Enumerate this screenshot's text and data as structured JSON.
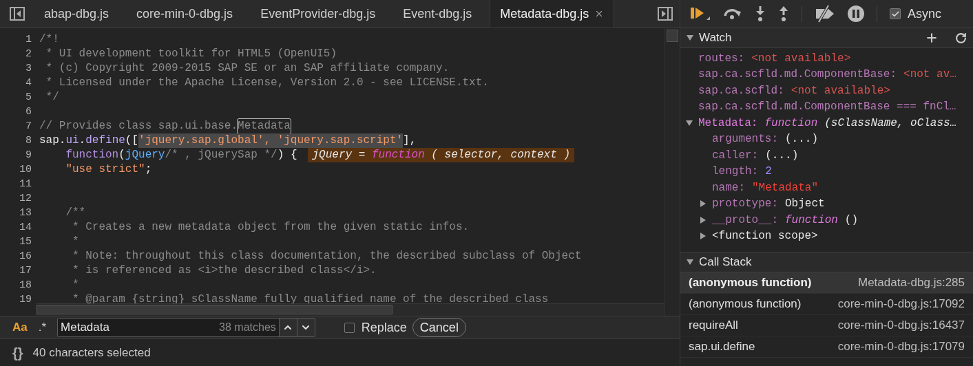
{
  "editor": {
    "tabs": [
      {
        "label": "abap-dbg.js",
        "selected": false
      },
      {
        "label": "core-min-0-dbg.js",
        "selected": false
      },
      {
        "label": "EventProvider-dbg.js",
        "selected": false
      },
      {
        "label": "Event-dbg.js",
        "selected": false
      },
      {
        "label": "Metadata-dbg.js",
        "selected": true
      }
    ],
    "lines": [
      {
        "number": "1",
        "segments": [
          {
            "text": "/*!",
            "kind": "comment"
          }
        ]
      },
      {
        "number": "2",
        "segments": [
          {
            "text": " * UI development toolkit for HTML5 (OpenUI5)",
            "kind": "comment"
          }
        ]
      },
      {
        "number": "3",
        "segments": [
          {
            "text": " * (c) Copyright 2009-2015 SAP SE or an SAP affiliate company.",
            "kind": "comment"
          }
        ]
      },
      {
        "number": "4",
        "segments": [
          {
            "text": " * Licensed under the Apache License, Version 2.0 - see LICENSE.txt.",
            "kind": "comment"
          }
        ]
      },
      {
        "number": "5",
        "segments": [
          {
            "text": " */",
            "kind": "comment"
          }
        ]
      },
      {
        "number": "6"
      },
      {
        "number": "7",
        "segments": [
          {
            "text": "// Provides class sap.ui.base.",
            "kind": "comment"
          },
          {
            "text": "Metadata",
            "kind": "comment",
            "match": true
          }
        ]
      },
      {
        "number": "8",
        "segments": [
          {
            "text": "sap.",
            "kind": "plain"
          },
          {
            "text": "ui",
            "kind": "property"
          },
          {
            "text": ".",
            "kind": "plain"
          },
          {
            "text": "define",
            "kind": "property"
          },
          {
            "text": "([",
            "kind": "plain"
          },
          {
            "text": "'jquery.sap.global', 'jquery.sap.script'",
            "kind": "string",
            "selected": true
          },
          {
            "text": "],",
            "kind": "plain"
          }
        ]
      },
      {
        "number": "9",
        "segments": [
          {
            "text": "    function",
            "kind": "keyword"
          },
          {
            "text": "(",
            "kind": "plain"
          },
          {
            "text": "jQuery",
            "kind": "param"
          },
          {
            "text": "/* , jQuerySap */",
            "kind": "comment"
          },
          {
            "text": ") {",
            "kind": "plain"
          }
        ],
        "inline_value": {
          "name": "jQuery",
          "operator": "=",
          "keyword": "function",
          "rest": "( selector, context )"
        }
      },
      {
        "number": "10",
        "segments": [
          {
            "text": "    \"use strict\"",
            "kind": "string"
          },
          {
            "text": ";",
            "kind": "plain"
          }
        ]
      },
      {
        "number": "11"
      },
      {
        "number": "12"
      },
      {
        "number": "13",
        "segments": [
          {
            "text": "    /**",
            "kind": "comment"
          }
        ]
      },
      {
        "number": "14",
        "segments": [
          {
            "text": "     * Creates a new metadata object from the given static infos.",
            "kind": "comment"
          }
        ]
      },
      {
        "number": "15",
        "segments": [
          {
            "text": "     *",
            "kind": "comment"
          }
        ]
      },
      {
        "number": "16",
        "segments": [
          {
            "text": "     * Note: throughout this class documentation, the described subclass of Object",
            "kind": "comment"
          }
        ]
      },
      {
        "number": "17",
        "segments": [
          {
            "text": "     * is referenced as <i>the described class</i>.",
            "kind": "comment"
          }
        ]
      },
      {
        "number": "18",
        "segments": [
          {
            "text": "     *",
            "kind": "comment"
          }
        ]
      },
      {
        "number": "19",
        "segments": [
          {
            "text": "     * @param {string} sClassName fully qualified name of the described class",
            "kind": "comment"
          }
        ]
      }
    ],
    "find": {
      "options": [
        {
          "label": "Aa",
          "on": true
        },
        {
          "label": ".*",
          "on": false
        }
      ],
      "value": "Metadata",
      "count": "38 matches",
      "replace": {
        "label": "Replace",
        "checked": false
      },
      "cancel": "Cancel"
    },
    "status": {
      "pretty_print": "{}",
      "text": "40 characters selected"
    }
  },
  "debugger": {
    "async": {
      "label": "Async",
      "checked": true
    },
    "watch": {
      "title": "Watch",
      "expanded": true,
      "items": [
        {
          "kind": "unavailable",
          "name": "routes:",
          "value": "<not available>"
        },
        {
          "kind": "unavailable",
          "name": "sap.ca.scfld.md.ComponentBase:",
          "value": "<not av…"
        },
        {
          "kind": "unavailable",
          "name": "sap.ca.scfld:",
          "value": "<not available>"
        },
        {
          "kind": "expression",
          "name": "sap.ca.scfld.md.ComponentBase === fnCl…"
        },
        {
          "kind": "function",
          "name": "Metadata:",
          "keyword": "function",
          "value": "(sClassName, oClass…",
          "expanded": true,
          "children": [
            {
              "kind": "plain",
              "name": "arguments:",
              "value": "(...)"
            },
            {
              "kind": "plain",
              "name": "caller:",
              "value": "(...)"
            },
            {
              "kind": "number",
              "name": "length:",
              "value": "2"
            },
            {
              "kind": "string",
              "name": "name:",
              "value": "\"Metadata\""
            },
            {
              "kind": "plain",
              "name": "prototype:",
              "value": "Object",
              "expanded": false
            },
            {
              "kind": "function",
              "name": "__proto__:",
              "keyword": "function",
              "value": "()",
              "expanded": false
            },
            {
              "kind": "scope",
              "name": "<function scope>",
              "expanded": false
            }
          ]
        }
      ]
    },
    "call_stack": {
      "title": "Call Stack",
      "expanded": true,
      "frames": [
        {
          "name": "(anonymous function)",
          "location": "Metadata-dbg.js:285",
          "selected": true
        },
        {
          "name": "(anonymous function)",
          "location": "core-min-0-dbg.js:17092",
          "selected": false
        },
        {
          "name": "requireAll",
          "location": "core-min-0-dbg.js:16437",
          "selected": false
        },
        {
          "name": "sap.ui.define",
          "location": "core-min-0-dbg.js:17079",
          "selected": false
        }
      ]
    }
  }
}
